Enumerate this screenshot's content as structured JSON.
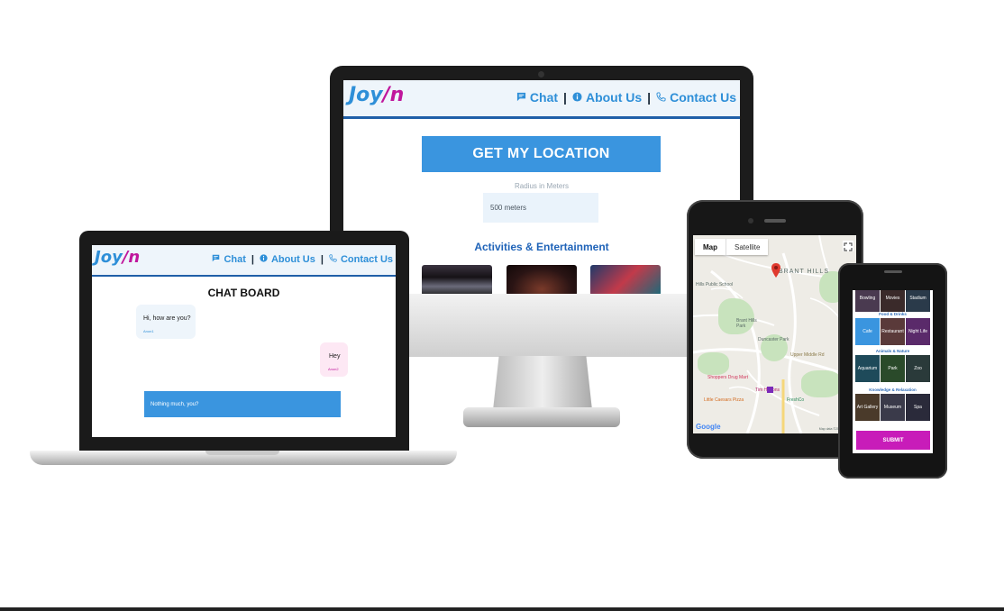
{
  "brand": {
    "logo_left": "Joy",
    "logo_right": "/n"
  },
  "nav": {
    "chat": "Chat",
    "about": "About Us",
    "contact": "Contact Us",
    "separator": "|"
  },
  "desktop": {
    "location_button": "GET MY LOCATION",
    "radius_label": "Radius in Meters",
    "radius_value": "500 meters",
    "section_title": "Activities & Entertainment"
  },
  "laptop": {
    "title": "CHAT BOARD",
    "messages": [
      {
        "text": "Hi, how are you?",
        "author": "Anon1"
      },
      {
        "text": "Hey",
        "author": "Anon2"
      }
    ],
    "input_value": "Nothing much, you?"
  },
  "tablet": {
    "map_tabs": [
      "Map",
      "Satellite"
    ],
    "labels": {
      "area": "BRANT HILLS",
      "school": "Hills Public School",
      "park1": "Brant Hills Park",
      "park2": "Duncaster Park",
      "road1": "Upper Middle Rd",
      "store1": "Shoppers Drug Mart",
      "store2": "Tim Hortons",
      "store3": "Little Caesars Pizza",
      "store4": "FreshCo",
      "google": "Google",
      "map_data": "Map data ©2019 Google"
    }
  },
  "phone": {
    "top_tiles": [
      "Bowling",
      "Movies",
      "Stadium"
    ],
    "categories": [
      {
        "label": "Food & Drinks",
        "tiles": [
          "Cafe",
          "Restaurant",
          "Night Life"
        ]
      },
      {
        "label": "Animals & Nature",
        "tiles": [
          "Aquarium",
          "Park",
          "Zoo"
        ]
      },
      {
        "label": "Knowledge & Relaxation",
        "tiles": [
          "Art Gallery",
          "Museum",
          "Spa"
        ]
      }
    ],
    "submit": "SUBMIT"
  },
  "colors": {
    "primary": "#3a95df",
    "accent": "#c0169c",
    "header_bg": "#eef5fb",
    "nav": "#2e8fd8"
  }
}
